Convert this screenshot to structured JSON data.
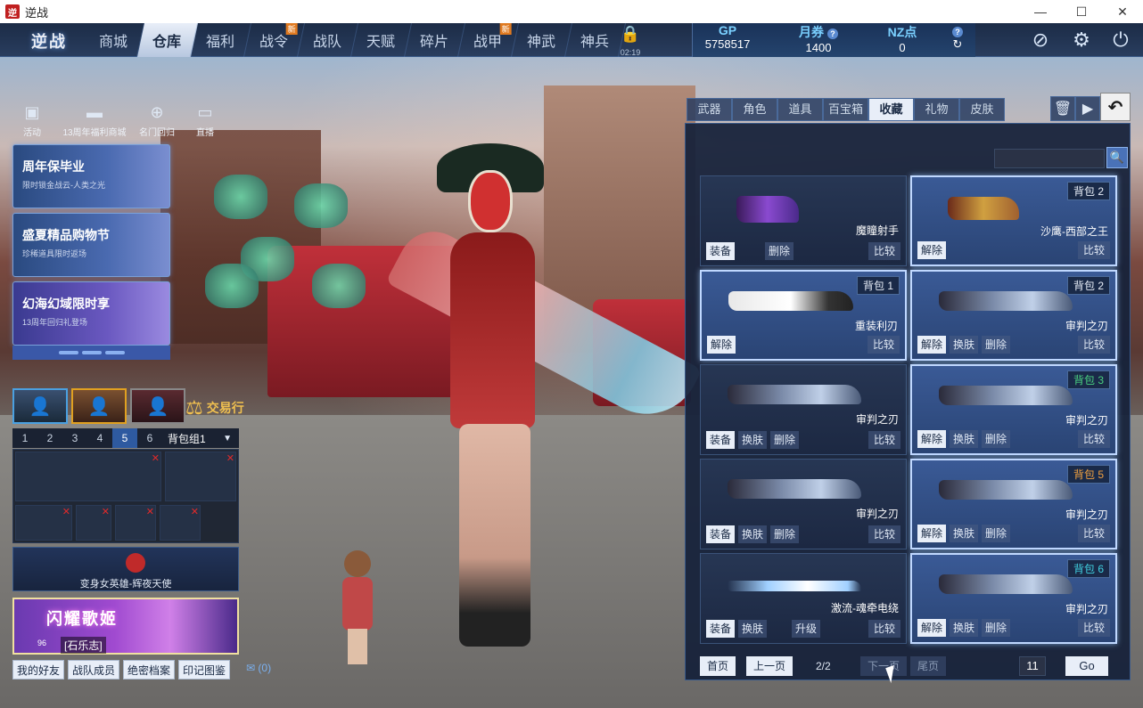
{
  "window": {
    "title": "逆战",
    "app_icon": "逆",
    "minimize": "—",
    "maximize": "☐",
    "close": "✕"
  },
  "logo": "逆战",
  "nav": [
    {
      "label": "商城",
      "new": false,
      "active": false
    },
    {
      "label": "仓库",
      "new": false,
      "active": true
    },
    {
      "label": "福利",
      "new": false,
      "active": false
    },
    {
      "label": "战令",
      "new": true,
      "active": false
    },
    {
      "label": "战队",
      "new": false,
      "active": false
    },
    {
      "label": "天赋",
      "new": false,
      "active": false
    },
    {
      "label": "碎片",
      "new": false,
      "active": false
    },
    {
      "label": "战甲",
      "new": true,
      "active": false
    },
    {
      "label": "神武",
      "new": false,
      "active": false
    },
    {
      "label": "神兵",
      "new": false,
      "active": false
    }
  ],
  "new_badge": "新",
  "lock": {
    "icon": "lock-icon",
    "time": "02:19"
  },
  "currency": {
    "gp": {
      "label": "GP",
      "value": "5758517"
    },
    "voucher": {
      "label": "月券",
      "value": "1400"
    },
    "nz": {
      "label": "NZ点",
      "value": "0"
    }
  },
  "quick": [
    {
      "label": "活动",
      "icon": "activity-icon"
    },
    {
      "label": "13周年福利商城",
      "icon": "mall-icon"
    },
    {
      "label": "名门回归",
      "icon": "return-icon"
    },
    {
      "label": "直播",
      "icon": "tv-icon"
    }
  ],
  "promos": [
    {
      "title": "周年保毕业",
      "subtitle": "限时锁金战云-人类之光"
    },
    {
      "title": "盛夏精品购物节",
      "subtitle": "珍稀道具限时返场"
    },
    {
      "title": "幻海幻域限时享",
      "subtitle": "13周年回归礼登场"
    }
  ],
  "trade": "交易行",
  "packs": {
    "items": [
      "1",
      "2",
      "3",
      "4",
      "5",
      "6"
    ],
    "active_index": 4,
    "selected": "背包组1"
  },
  "hero_transform": "变身女英雄-辉夜天使",
  "banner": {
    "title": "闪耀歌姬",
    "level": "96",
    "name": "[石乐志]"
  },
  "bottom_links": [
    "我的好友",
    "战队成员",
    "绝密档案",
    "印记图鉴"
  ],
  "mail": "(0)",
  "rp": {
    "tabs": [
      "武器",
      "角色",
      "道具",
      "百宝箱",
      "收藏",
      "礼物",
      "皮肤"
    ],
    "active_tab": 4,
    "back_icon": "undo-icon"
  },
  "cards": [
    {
      "name": "魔瞳射手",
      "pack": "",
      "gun": "purple",
      "actions": [
        "装备",
        "删除"
      ],
      "compare": "比较",
      "highlight": false
    },
    {
      "name": "沙鹰-西部之王",
      "pack": "背包 2",
      "pack_color": "",
      "gun": "gold",
      "actions": [
        "解除"
      ],
      "compare": "比较",
      "highlight": true
    },
    {
      "name": "重装利刃",
      "pack": "背包 1",
      "pack_color": "",
      "gun": "white",
      "actions": [
        "解除"
      ],
      "compare": "比较",
      "highlight": true
    },
    {
      "name": "审判之刃",
      "pack": "背包 2",
      "pack_color": "",
      "gun": "blade",
      "actions": [
        "解除",
        "换肤",
        "删除"
      ],
      "compare": "比较",
      "highlight": true
    },
    {
      "name": "审判之刃",
      "pack": "",
      "gun": "blade",
      "actions": [
        "装备",
        "换肤",
        "删除"
      ],
      "compare": "比较",
      "highlight": false
    },
    {
      "name": "审判之刃",
      "pack": "背包 3",
      "pack_color": "g",
      "gun": "blade",
      "actions": [
        "解除",
        "换肤",
        "删除"
      ],
      "compare": "比较",
      "highlight": true
    },
    {
      "name": "审判之刃",
      "pack": "",
      "gun": "blade",
      "actions": [
        "装备",
        "换肤",
        "删除"
      ],
      "compare": "比较",
      "highlight": false
    },
    {
      "name": "审判之刃",
      "pack": "背包 5",
      "pack_color": "o",
      "gun": "blade",
      "actions": [
        "解除",
        "换肤",
        "删除"
      ],
      "compare": "比较",
      "highlight": true
    },
    {
      "name": "激流-魂牵电绕",
      "pack": "",
      "gun": "beam",
      "actions": [
        "装备",
        "换肤",
        "升级"
      ],
      "compare": "比较",
      "highlight": false
    },
    {
      "name": "审判之刃",
      "pack": "背包 6",
      "pack_color": "c",
      "gun": "blade",
      "actions": [
        "解除",
        "换肤",
        "删除"
      ],
      "compare": "比较",
      "highlight": true
    }
  ],
  "pager": {
    "first": "首页",
    "prev": "上一页",
    "info": "2/2",
    "next": "下一页",
    "last": "尾页",
    "page_input": "11",
    "go": "Go"
  }
}
